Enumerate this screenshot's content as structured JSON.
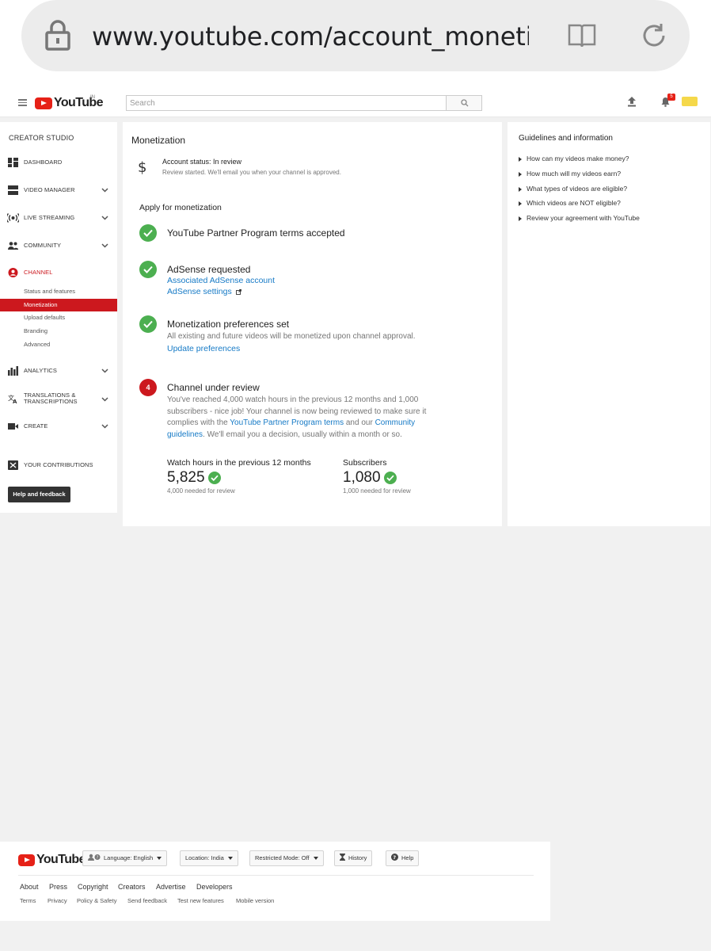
{
  "browser": {
    "url": "www.youtube.com/account_monetization"
  },
  "header": {
    "logo_text": "YouTube",
    "region": "IN",
    "search_placeholder": "Search",
    "notification_count": "5"
  },
  "sidebar": {
    "title": "CREATOR STUDIO",
    "items": [
      {
        "label": "DASHBOARD"
      },
      {
        "label": "VIDEO MANAGER"
      },
      {
        "label": "LIVE STREAMING"
      },
      {
        "label": "COMMUNITY"
      },
      {
        "label": "CHANNEL"
      },
      {
        "label": "ANALYTICS"
      },
      {
        "label": "TRANSLATIONS &"
      },
      {
        "label": "TRANSCRIPTIONS"
      },
      {
        "label": "CREATE"
      },
      {
        "label": "YOUR CONTRIBUTIONS"
      }
    ],
    "channel_sub": [
      "Status and features",
      "Monetization",
      "Upload defaults",
      "Branding",
      "Advanced"
    ],
    "help_button": "Help and feedback"
  },
  "main": {
    "title": "Monetization",
    "account_status": "Account status: In review",
    "account_note": "Review started. We'll email you when your channel is approved.",
    "apply_title": "Apply for monetization",
    "step1": {
      "heading": "YouTube Partner Program terms accepted"
    },
    "step2": {
      "heading": "AdSense requested",
      "link1": "Associated AdSense account",
      "link2": "AdSense settings"
    },
    "step3": {
      "heading": "Monetization preferences set",
      "body": "All existing and future videos will be monetized upon channel approval.",
      "link": "Update preferences"
    },
    "step4": {
      "number": "4",
      "heading": "Channel under review",
      "body_a": "You've reached 4,000 watch hours in the previous 12 months and 1,000 subscribers - nice job! Your channel is now being reviewed to make sure it complies with the ",
      "link_a": "YouTube Partner Program terms",
      "body_b": " and our ",
      "link_b": "Community guidelines",
      "body_c": ". We'll email you a decision, usually within a month or so."
    },
    "watch_hours": {
      "label": "Watch hours in the previous 12 months",
      "value": "5,825",
      "note": "4,000 needed for review"
    },
    "subscribers": {
      "label": "Subscribers",
      "value": "1,080",
      "note": "1,000 needed for review"
    }
  },
  "guidelines": {
    "title": "Guidelines and information",
    "items": [
      "How can my videos make money?",
      "How much will my videos earn?",
      "What types of videos are eligible?",
      "Which videos are NOT eligible?",
      "Review your agreement with YouTube"
    ]
  },
  "footer": {
    "logo_text": "YouTube",
    "language": "Language: English",
    "location": "Location: India",
    "restricted": "Restricted Mode: Off",
    "history": "History",
    "help": "Help",
    "links_primary": [
      "About",
      "Press",
      "Copyright",
      "Creators",
      "Advertise",
      "Developers"
    ],
    "links_secondary": [
      "Terms",
      "Privacy",
      "Policy & Safety",
      "Send feedback",
      "Test new features",
      "Mobile version"
    ]
  },
  "colors": {
    "brand_red": "#cc181e",
    "link_blue": "#167ac6",
    "success_green": "#4caf50"
  }
}
